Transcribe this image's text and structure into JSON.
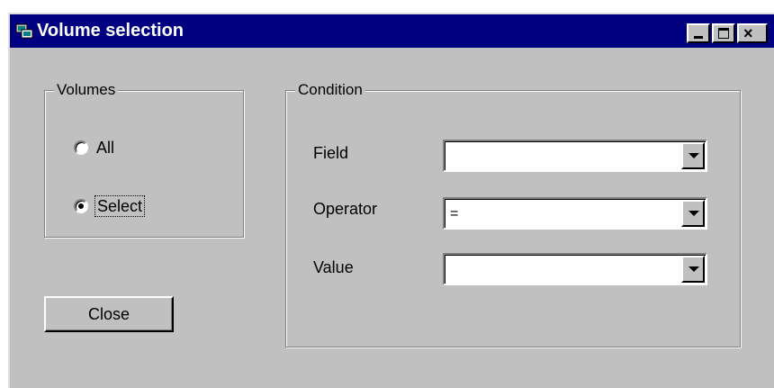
{
  "window": {
    "title": "Volume selection",
    "icon": "app-icon",
    "controls": {
      "minimize": "minimize-icon",
      "maximize": "maximize-icon",
      "close": "close-icon",
      "close_glyph": "×"
    }
  },
  "volumes": {
    "label": "Volumes",
    "options": [
      {
        "label": "All",
        "selected": false
      },
      {
        "label": "Select",
        "selected": true,
        "focused": true
      }
    ]
  },
  "condition": {
    "label": "Condition",
    "fields": [
      {
        "label": "Field",
        "value": ""
      },
      {
        "label": "Operator",
        "value": "="
      },
      {
        "label": "Value",
        "value": ""
      }
    ]
  },
  "close_button": {
    "label": "Close"
  },
  "colors": {
    "face": "#c0c0c0",
    "titlebar": "#000080",
    "title_text": "#ffffff"
  }
}
